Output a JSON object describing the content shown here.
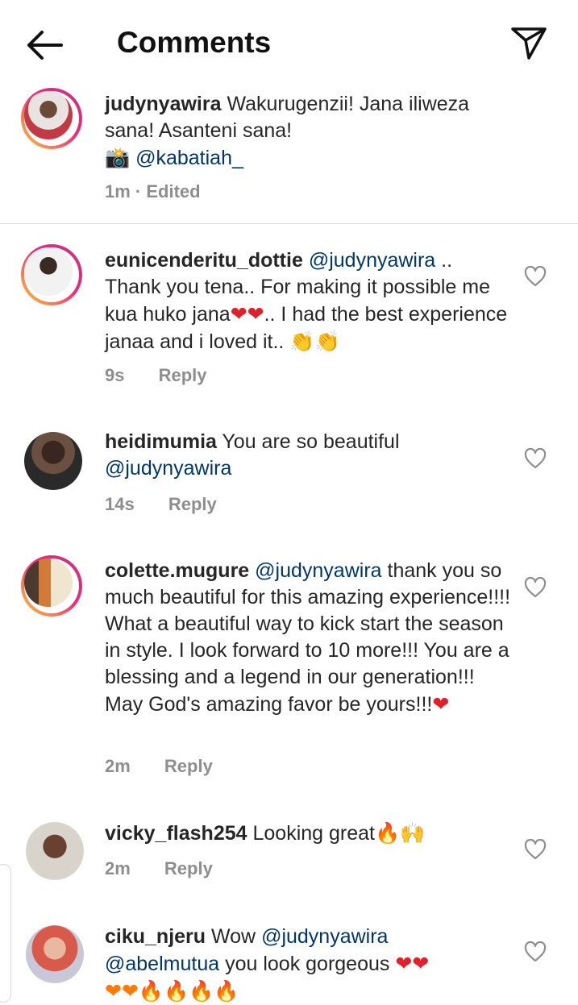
{
  "header": {
    "title": "Comments"
  },
  "caption": {
    "username": "judynyawira",
    "text": "Wakurugenzii! Jana iliweza sana! Asanteni sana!",
    "camera_emoji": "📸",
    "mention": "@kabatiah_",
    "time": "1m",
    "edited": "· Edited"
  },
  "comments": [
    {
      "username": "eunicenderitu_dottie",
      "mention": "@judynyawira",
      "text1": " .. Thank you tena.. For making it possible me kua huko jana",
      "hearts": "❤❤",
      "text2": ".. I had the best experience janaa and i loved it.. ",
      "claps": "👏👏",
      "time": "9s",
      "reply": "Reply"
    },
    {
      "username": "heidimumia",
      "text": " You are so beautiful ",
      "mention": "@judynyawira",
      "time": "14s",
      "reply": "Reply"
    },
    {
      "username": "colette.mugure",
      "mention": "@judynyawira",
      "text": " thank you so much beautiful for this amazing experience!!!! What a beautiful way to kick start the season in style. I look forward to 10 more!!! You are a blessing and a legend in our generation!!! May God's amazing favor be yours!!!",
      "heart": "❤",
      "time": "2m",
      "reply": "Reply"
    },
    {
      "username": "vicky_flash254",
      "text": " Looking great",
      "emojis": "🔥🙌",
      "time": "2m",
      "reply": "Reply"
    },
    {
      "username": "ciku_njeru",
      "text1": " Wow ",
      "mention1": "@judynyawira",
      "mention2": "@abelmutua",
      "text2": "  you look gorgeous ",
      "hearts": "❤❤",
      "line3": "❤❤🔥🔥🔥🔥"
    }
  ]
}
